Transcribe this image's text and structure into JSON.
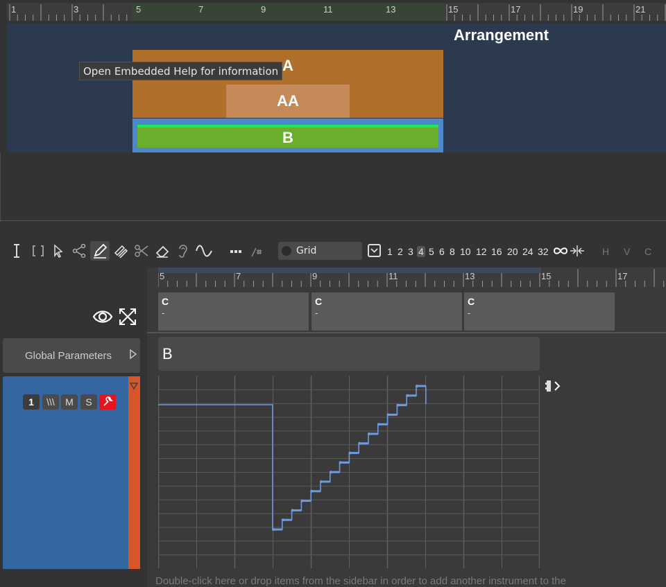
{
  "arrangement": {
    "title": "Arrangement",
    "ruler_labels": [
      "1",
      "3",
      "5",
      "7",
      "9",
      "11",
      "13",
      "15",
      "17",
      "19",
      "21"
    ],
    "regions": {
      "a": "A",
      "aa": "AA",
      "b": "B"
    },
    "tooltip": "Open Embedded Help for information"
  },
  "toolbar": {
    "tools": [
      "text-cursor-icon",
      "bracket-select-icon",
      "pointer-icon",
      "share-icon",
      "pencil-icon",
      "multi-pencil-icon",
      "scissors-icon",
      "eraser-icon",
      "ear-icon",
      "sine-wave-icon",
      "more-dots-icon",
      "sharp-icon"
    ],
    "active_tool": "pencil-icon",
    "grid_label": "Grid",
    "grid_values": [
      "1",
      "2",
      "3",
      "4",
      "5",
      "6",
      "8",
      "10",
      "12",
      "16",
      "20",
      "24",
      "32"
    ],
    "grid_selected": "4",
    "hvc": [
      "H",
      "V",
      "C"
    ]
  },
  "track": {
    "global_params_label": "Global Parameters",
    "buttons": {
      "number": "1",
      "pattern": "\\\\\\",
      "mute": "M",
      "solo": "S"
    }
  },
  "editor": {
    "ruler_labels": [
      "5",
      "7",
      "9",
      "11",
      "13",
      "15",
      "17"
    ],
    "chords": [
      {
        "name": "C",
        "sub": "-"
      },
      {
        "name": "C",
        "sub": "-"
      },
      {
        "name": "C",
        "sub": "-"
      }
    ],
    "pattern_name": "B",
    "bottom_hint": "Double-click here or drop items from the sidebar in order to add another instrument to the"
  },
  "colors": {
    "region_a": "#b0702c",
    "region_aa": "#c58a58",
    "region_b": "#6aae2c",
    "track": "#3467a2",
    "track_accent": "#d8562a",
    "automation_line": "#6b9be0",
    "wrench_button": "#e8141c"
  }
}
